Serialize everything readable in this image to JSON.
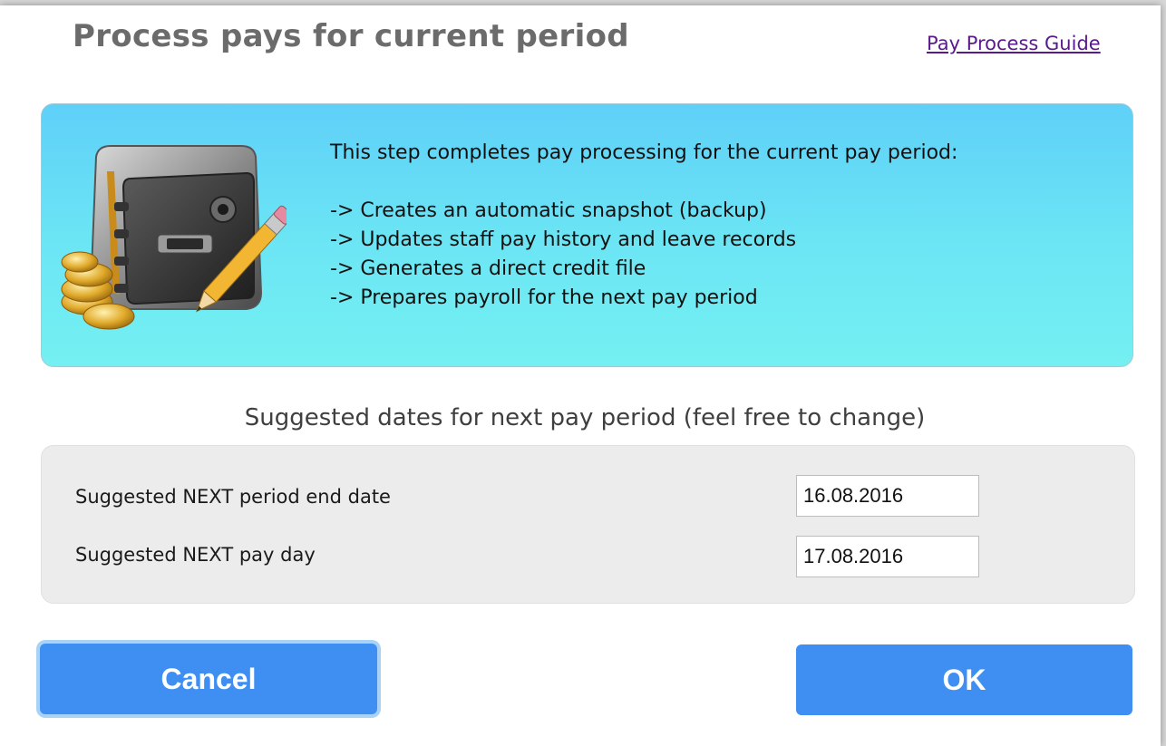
{
  "dialog": {
    "title": "Process pays for current period",
    "guide_link": "Pay Process Guide"
  },
  "info": {
    "illustration": "safe-with-coins-and-pencil-icon",
    "intro": "This step completes pay processing for the current pay period:",
    "steps": [
      "-> Creates an automatic snapshot (backup)",
      "-> Updates staff pay history and leave records",
      "-> Generates a direct credit file",
      "-> Prepares payroll for the next pay period"
    ]
  },
  "dates": {
    "heading": "Suggested dates for next pay period (feel free to change)",
    "end_date_label": "Suggested NEXT period end date",
    "end_date_value": "16.08.2016",
    "pay_day_label": "Suggested NEXT pay day",
    "pay_day_value": "17.08.2016"
  },
  "buttons": {
    "cancel_label": "Cancel",
    "ok_label": "OK"
  },
  "colors": {
    "button_blue": "#3f8ff2",
    "panel_cyan": "#6ce6f4",
    "link_purple": "#5a1a8c"
  }
}
